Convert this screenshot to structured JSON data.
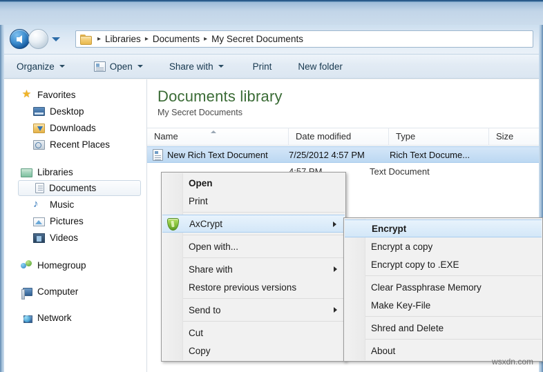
{
  "window": {
    "title_bar_color": "#cbdcec"
  },
  "navigation": {
    "back_button": "Back",
    "forward_button": "Forward",
    "dropdown": "Recent pages",
    "breadcrumb": {
      "folder_icon": "folder-icon",
      "separator": "▸",
      "items": [
        "Libraries",
        "Documents",
        "My Secret Documents"
      ]
    }
  },
  "toolbar": {
    "items": [
      {
        "label": "Organize",
        "caret": true,
        "icon": null
      },
      {
        "label": "Open",
        "caret": true,
        "icon": "open-file-icon"
      },
      {
        "label": "Share with",
        "caret": true,
        "icon": null
      },
      {
        "label": "Print",
        "caret": false,
        "icon": null
      },
      {
        "label": "New folder",
        "caret": false,
        "icon": null
      }
    ]
  },
  "sidebar": {
    "groups": [
      {
        "header": {
          "label": "Favorites",
          "icon": "star-icon"
        },
        "children": [
          {
            "label": "Desktop",
            "icon": "desktop-icon"
          },
          {
            "label": "Downloads",
            "icon": "downloads-icon"
          },
          {
            "label": "Recent Places",
            "icon": "recent-places-icon"
          }
        ]
      },
      {
        "header": {
          "label": "Libraries",
          "icon": "libraries-icon"
        },
        "children": [
          {
            "label": "Documents",
            "icon": "documents-icon",
            "selected": true
          },
          {
            "label": "Music",
            "icon": "music-icon"
          },
          {
            "label": "Pictures",
            "icon": "pictures-icon"
          },
          {
            "label": "Videos",
            "icon": "videos-icon"
          }
        ]
      },
      {
        "header": {
          "label": "Homegroup",
          "icon": "homegroup-icon"
        },
        "children": []
      },
      {
        "header": {
          "label": "Computer",
          "icon": "computer-icon"
        },
        "children": []
      },
      {
        "header": {
          "label": "Network",
          "icon": "network-icon"
        },
        "children": []
      }
    ]
  },
  "content": {
    "library_title": "Documents library",
    "library_subtitle": "My Secret Documents",
    "columns": [
      {
        "label": "Name",
        "sorted": true
      },
      {
        "label": "Date modified",
        "sorted": false
      },
      {
        "label": "Type",
        "sorted": false
      },
      {
        "label": "Size",
        "sorted": false
      }
    ],
    "rows": [
      {
        "name": "New Rich Text Document",
        "date": "7/25/2012 4:57 PM",
        "type": "Rich Text Docume...",
        "size": "",
        "icon": "rich-text-file-icon",
        "selected": true
      },
      {
        "name": "",
        "date": "4:57 PM",
        "type": "Text Document",
        "size": "",
        "icon": null,
        "selected": false
      }
    ]
  },
  "context_menu": {
    "items": [
      {
        "label": "Open",
        "bold": true,
        "submenu": false,
        "icon": null,
        "highlight": false
      },
      {
        "label": "Print",
        "bold": false,
        "submenu": false,
        "icon": null,
        "highlight": false
      },
      {
        "separator": true
      },
      {
        "label": "AxCrypt",
        "bold": false,
        "submenu": true,
        "icon": "axcrypt-shield-icon",
        "highlight": true
      },
      {
        "separator": true
      },
      {
        "label": "Open with...",
        "bold": false,
        "submenu": false,
        "icon": null,
        "highlight": false
      },
      {
        "separator": true
      },
      {
        "label": "Share with",
        "bold": false,
        "submenu": true,
        "icon": null,
        "highlight": false
      },
      {
        "label": "Restore previous versions",
        "bold": false,
        "submenu": false,
        "icon": null,
        "highlight": false
      },
      {
        "separator": true
      },
      {
        "label": "Send to",
        "bold": false,
        "submenu": true,
        "icon": null,
        "highlight": false
      },
      {
        "separator": true
      },
      {
        "label": "Cut",
        "bold": false,
        "submenu": false,
        "icon": null,
        "highlight": false
      },
      {
        "label": "Copy",
        "bold": false,
        "submenu": false,
        "icon": null,
        "highlight": false
      }
    ]
  },
  "submenu": {
    "items": [
      {
        "label": "Encrypt",
        "bold": true,
        "highlight": true
      },
      {
        "label": "Encrypt a copy",
        "bold": false,
        "highlight": false
      },
      {
        "label": "Encrypt copy to .EXE",
        "bold": false,
        "highlight": false
      },
      {
        "separator": true
      },
      {
        "label": "Clear Passphrase Memory",
        "bold": false,
        "highlight": false
      },
      {
        "label": "Make Key-File",
        "bold": false,
        "highlight": false
      },
      {
        "separator": true
      },
      {
        "label": "Shred and Delete",
        "bold": false,
        "highlight": false
      },
      {
        "separator": true
      },
      {
        "label": "About",
        "bold": false,
        "highlight": false
      }
    ]
  },
  "watermark": {
    "text": "wsxdn.com"
  }
}
